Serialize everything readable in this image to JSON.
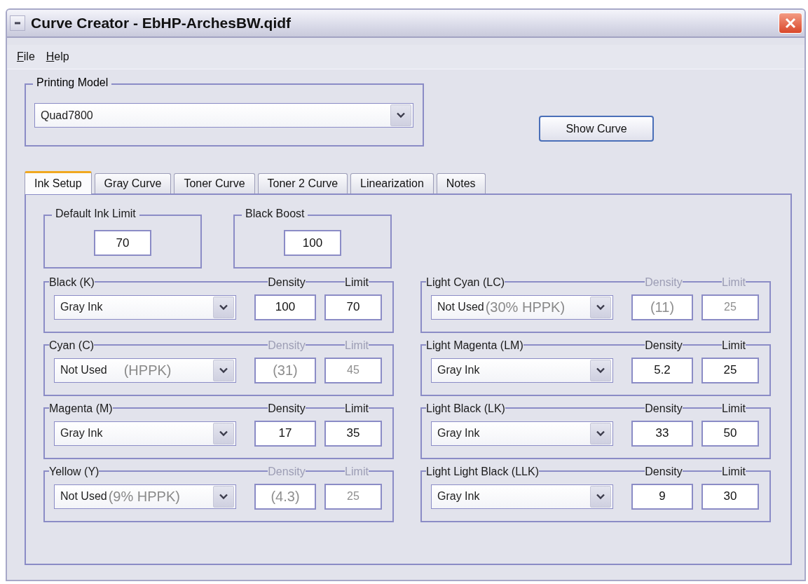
{
  "window": {
    "title": "Curve Creator - EbHP-ArchesBW.qidf"
  },
  "menu": [
    "File",
    "Help"
  ],
  "printing_model": {
    "label": "Printing Model",
    "value": "Quad7800"
  },
  "show_curve_button": "Show Curve",
  "tabs": [
    {
      "label": "Ink Setup",
      "selected": true
    },
    {
      "label": "Gray Curve",
      "selected": false
    },
    {
      "label": "Toner Curve",
      "selected": false
    },
    {
      "label": "Toner 2 Curve",
      "selected": false
    },
    {
      "label": "Linearization",
      "selected": false
    },
    {
      "label": "Notes",
      "selected": false
    }
  ],
  "default_ink_limit": {
    "label": "Default Ink Limit",
    "value": "70"
  },
  "black_boost": {
    "label": "Black Boost",
    "value": "100"
  },
  "inks_left": [
    {
      "name": "Black (K)",
      "density_label": "Density",
      "limit_label": "Limit",
      "mode": "Gray Ink",
      "enabled": true,
      "density": "100",
      "limit": "70"
    },
    {
      "name": "Cyan (C)",
      "density_label": "Density",
      "limit_label": "Limit",
      "mode": "Not Used",
      "note": "(HPPK)",
      "enabled": false,
      "density": "(31)",
      "limit": "45"
    },
    {
      "name": "Magenta (M)",
      "density_label": "Density",
      "limit_label": "Limit",
      "mode": "Gray Ink",
      "enabled": true,
      "density": "17",
      "limit": "35"
    },
    {
      "name": "Yellow (Y)",
      "density_label": "Density",
      "limit_label": "Limit",
      "mode": "Not Used",
      "note": "(9% HPPK)",
      "enabled": false,
      "density": "(4.3)",
      "limit": "25"
    }
  ],
  "inks_right": [
    {
      "name": "Light Cyan (LC)",
      "density_label": "Density",
      "limit_label": "Limit",
      "mode": "Not Used",
      "note": "(30% HPPK)",
      "enabled": false,
      "density": "(11)",
      "limit": "25"
    },
    {
      "name": "Light Magenta (LM)",
      "density_label": "Density",
      "limit_label": "Limit",
      "mode": "Gray Ink",
      "enabled": true,
      "density": "5.2",
      "limit": "25"
    },
    {
      "name": "Light Black (LK)",
      "density_label": "Density",
      "limit_label": "Limit",
      "mode": "Gray Ink",
      "enabled": true,
      "density": "33",
      "limit": "50"
    },
    {
      "name": "Light Light Black (LLK)",
      "density_label": "Density",
      "limit_label": "Limit",
      "mode": "Gray Ink",
      "enabled": true,
      "density": "9",
      "limit": "30"
    }
  ]
}
